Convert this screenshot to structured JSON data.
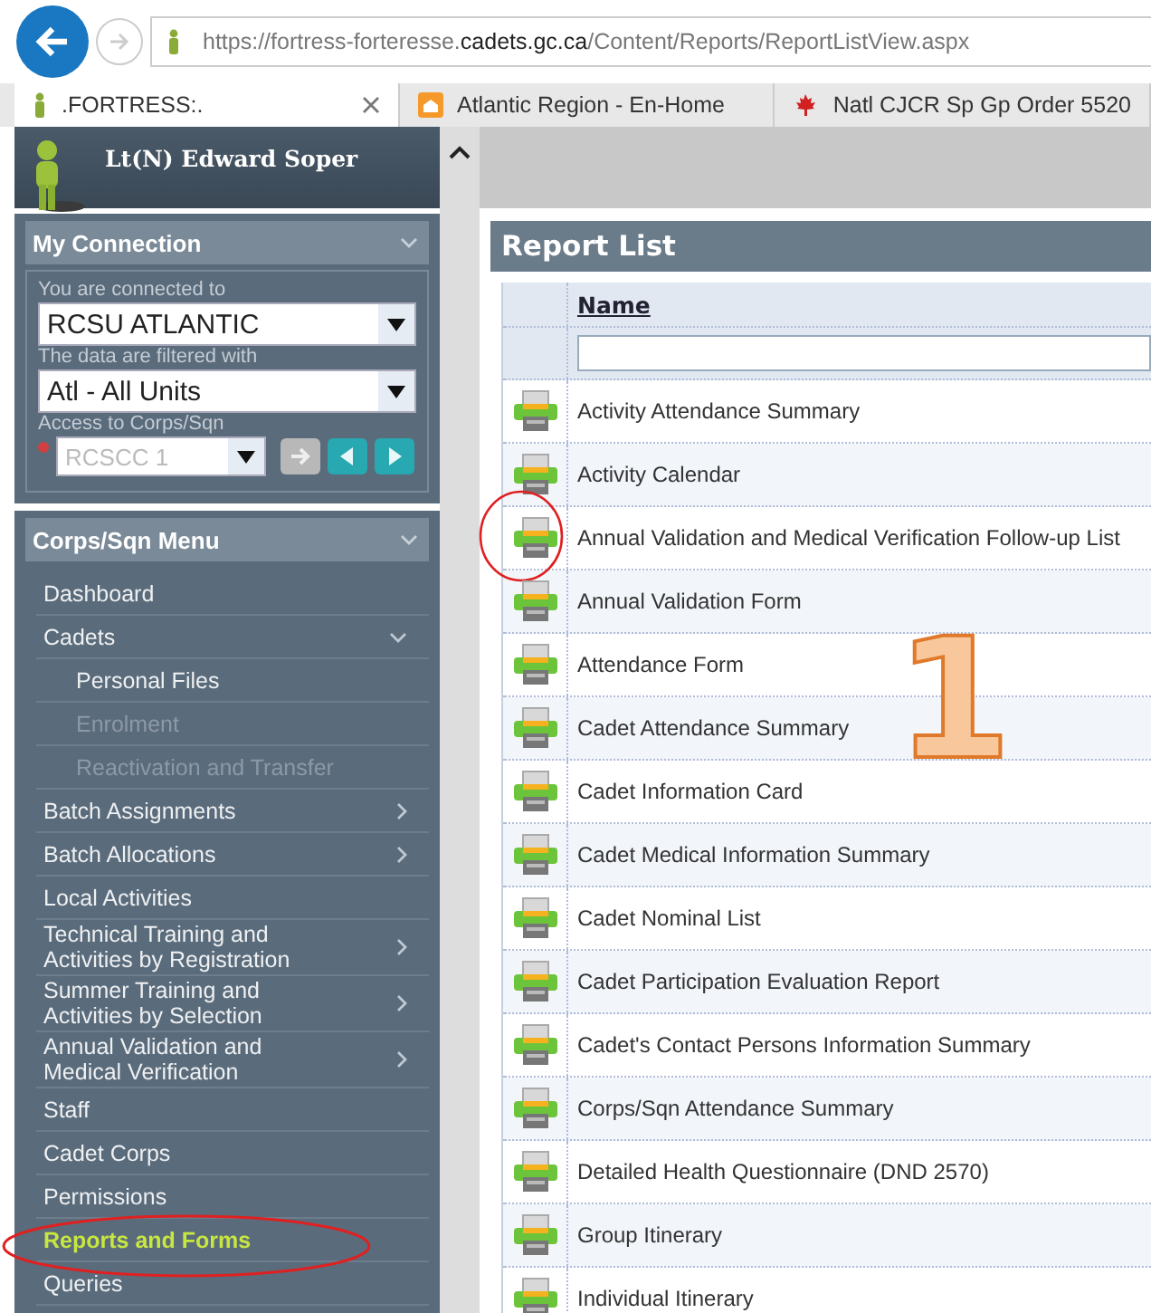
{
  "browser": {
    "address": "https://fortress-forteresse.**cadets.gc.ca**/Content/Reports/ReportListView.aspx",
    "tabs": [
      {
        "label": ".FORTRESS:.",
        "selected": true,
        "closable": true,
        "kind": "figure"
      },
      {
        "label": "Atlantic Region - En-Home",
        "selected": false,
        "closable": false,
        "kind": "house"
      },
      {
        "label": "Natl CJCR Sp Gp Order 5520",
        "selected": false,
        "closable": false,
        "kind": "leaf"
      }
    ]
  },
  "user": {
    "name": "Lt(N) Edward Soper"
  },
  "connection": {
    "title": "My Connection",
    "connected_label": "You are connected to",
    "connected_value": "RCSU ATLANTIC",
    "filter_label": "The data are filtered with",
    "filter_value": "Atl - All Units",
    "access_label": "Access to Corps/Sqn",
    "access_value": "RCSCC 1",
    "access_disabled": true
  },
  "menu": {
    "title": "Corps/Sqn Menu",
    "items": [
      {
        "label": "Dashboard",
        "has_submenu": false,
        "selected": false,
        "circled": false
      },
      {
        "label": "Cadets",
        "expanded": true,
        "selected": false,
        "circled": false,
        "children": [
          {
            "label": "Personal Files",
            "disabled": false
          },
          {
            "label": "Enrolment",
            "disabled": true
          },
          {
            "label": "Reactivation and Transfer",
            "disabled": true
          }
        ]
      },
      {
        "label": "Batch Assignments",
        "has_submenu": true,
        "selected": false,
        "circled": false
      },
      {
        "label": "Batch Allocations",
        "has_submenu": true,
        "selected": false,
        "circled": false
      },
      {
        "label": "Local Activities",
        "has_submenu": false,
        "selected": false,
        "circled": false
      },
      {
        "label": "Technical Training and Activities by Registration",
        "has_submenu": true,
        "selected": false,
        "circled": false
      },
      {
        "label": "Summer Training and Activities by Selection",
        "has_submenu": true,
        "selected": false,
        "circled": false
      },
      {
        "label": "Annual Validation and Medical Verification",
        "has_submenu": true,
        "selected": false,
        "circled": false
      },
      {
        "label": "Staff",
        "has_submenu": false,
        "selected": false,
        "circled": false
      },
      {
        "label": "Cadet Corps",
        "has_submenu": false,
        "selected": false,
        "circled": false
      },
      {
        "label": "Permissions",
        "has_submenu": false,
        "selected": false,
        "circled": false
      },
      {
        "label": "Reports and Forms",
        "has_submenu": false,
        "selected": true,
        "circled": true
      },
      {
        "label": "Queries",
        "has_submenu": false,
        "selected": false,
        "circled": false
      }
    ]
  },
  "report_list": {
    "title": "Report List",
    "column": "Name",
    "rows": [
      {
        "name": "Activity Attendance Summary",
        "circled": false
      },
      {
        "name": "Activity Calendar",
        "circled": false
      },
      {
        "name": "Annual Validation and Medical Verification Follow-up List",
        "circled": true
      },
      {
        "name": "Annual Validation Form",
        "circled": false
      },
      {
        "name": "Attendance Form",
        "circled": false
      },
      {
        "name": "Cadet Attendance Summary",
        "circled": false
      },
      {
        "name": "Cadet Information Card",
        "circled": false
      },
      {
        "name": "Cadet Medical Information Summary",
        "circled": false
      },
      {
        "name": "Cadet Nominal List",
        "circled": false
      },
      {
        "name": "Cadet Participation Evaluation Report",
        "circled": false
      },
      {
        "name": "Cadet's Contact Persons Information Summary",
        "circled": false
      },
      {
        "name": "Corps/Sqn Attendance Summary",
        "circled": false
      },
      {
        "name": "Detailed Health Questionnaire (DND 2570)",
        "circled": false
      },
      {
        "name": "Group Itinerary",
        "circled": false
      },
      {
        "name": "Individual Itinerary",
        "circled": false
      }
    ]
  },
  "annotations": {
    "step_number": "1"
  }
}
